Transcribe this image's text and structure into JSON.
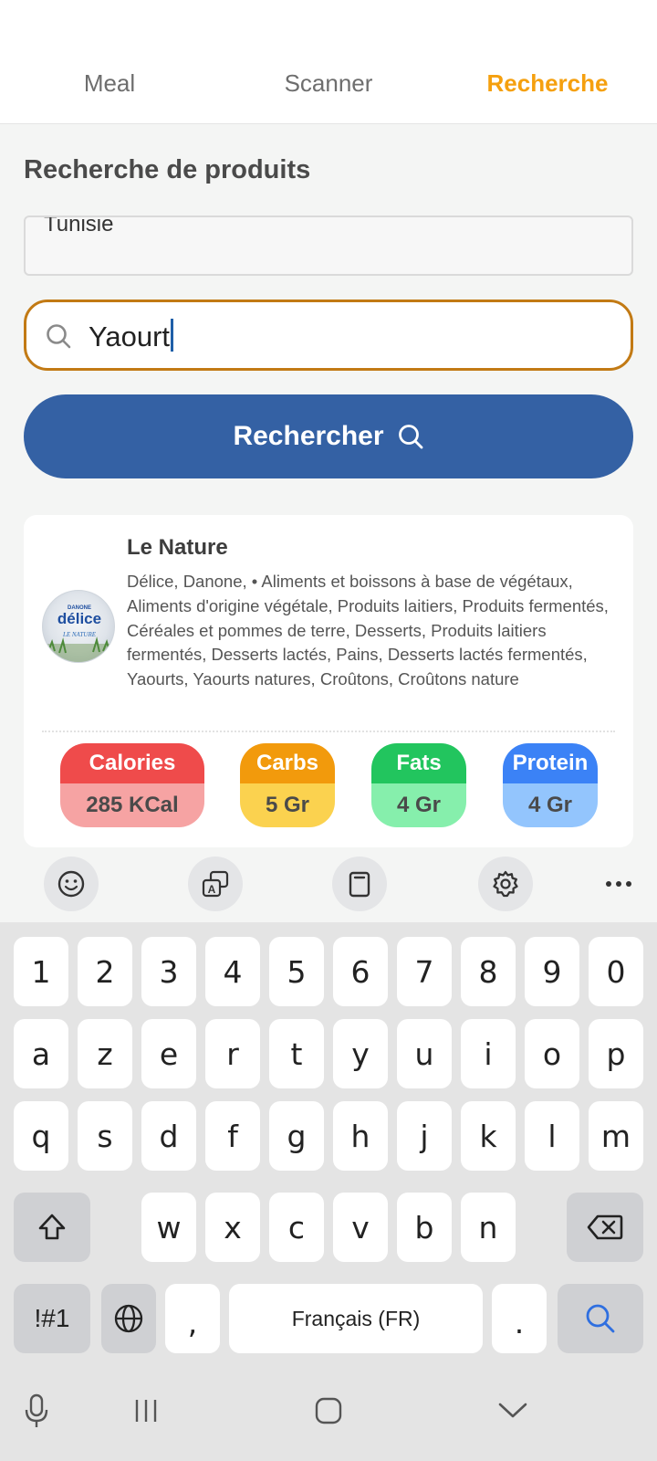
{
  "tabs": [
    {
      "label": "Meal",
      "active": false
    },
    {
      "label": "Scanner",
      "active": false
    },
    {
      "label": "Recherche",
      "active": true
    }
  ],
  "page": {
    "title": "Recherche de produits",
    "country_value": "Tunisie",
    "search_value": "Yaourt",
    "search_button_label": "Rechercher"
  },
  "result": {
    "name": "Le Nature",
    "description": "Délice, Danone, • Aliments et boissons à base de végétaux, Aliments d'origine végétale, Produits laitiers, Produits fermentés, Céréales et pommes de terre, Desserts, Produits laitiers fermentés, Desserts lactés, Pains, Desserts lactés fermentés, Yaourts, Yaourts natures, Croûtons, Croûtons nature",
    "thumb": {
      "brand": "délice",
      "maker": "DANONE",
      "variant": "LE NATURE"
    },
    "nutrition": {
      "calories": {
        "label": "Calories",
        "value": "285 KCal"
      },
      "carbs": {
        "label": "Carbs",
        "value": "5 Gr"
      },
      "fats": {
        "label": "Fats",
        "value": "4 Gr"
      },
      "protein": {
        "label": "Protein",
        "value": "4 Gr"
      }
    }
  },
  "keyboard": {
    "toolbar_icons": [
      "emoji-icon",
      "translate-icon",
      "clipboard-icon",
      "settings-icon",
      "more-icon"
    ],
    "row_numbers": [
      "1",
      "2",
      "3",
      "4",
      "5",
      "6",
      "7",
      "8",
      "9",
      "0"
    ],
    "row1": [
      "a",
      "z",
      "e",
      "r",
      "t",
      "y",
      "u",
      "i",
      "o",
      "p"
    ],
    "row2": [
      "q",
      "s",
      "d",
      "f",
      "g",
      "h",
      "j",
      "k",
      "l",
      "m"
    ],
    "row3": [
      "w",
      "x",
      "c",
      "v",
      "b",
      "n"
    ],
    "symbols_label": "!#1",
    "comma": ",",
    "space_label": "Français (FR)",
    "period": "."
  },
  "colors": {
    "accent": "#f5a00f",
    "primary": "#3461a4",
    "search_border": "#c27a14"
  }
}
